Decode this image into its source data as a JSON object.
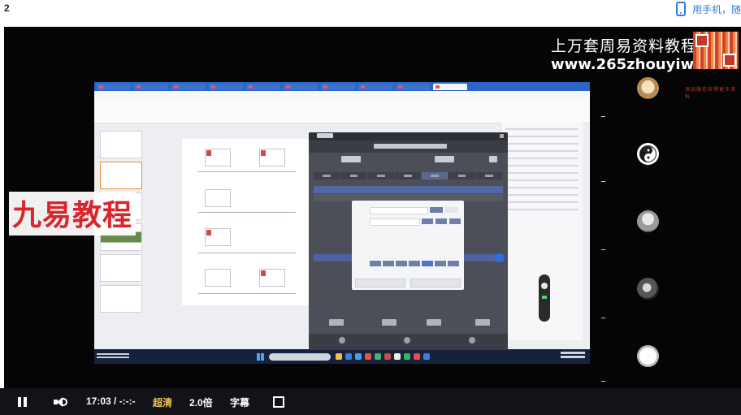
{
  "page_number": "2",
  "phone_link": {
    "text": "用手机，随"
  },
  "watermark": {
    "line1": "上万套周易资料教程",
    "line2": "www.265zhouyiw.com",
    "qr_caption": "添加微信获得更多资料"
  },
  "brand_overlay": "九易教程",
  "player": {
    "time": "17:03 / -:-:-",
    "quality": "超清",
    "speed": "2.0倍",
    "subtitles": "字幕"
  },
  "colors": {
    "accent_blue": "#2f7be0",
    "brand_red": "#d9252b",
    "quality_gold": "#f2c14e",
    "player_bg": "#111318"
  },
  "icons": [
    "phone-icon",
    "pause-icon",
    "volume-icon",
    "fullscreen-icon",
    "taiji-icon"
  ]
}
